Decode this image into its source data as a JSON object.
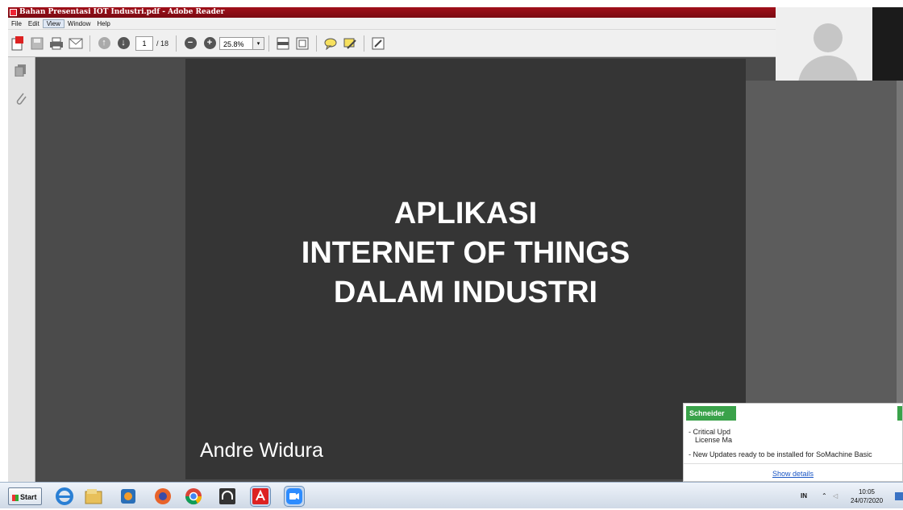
{
  "window": {
    "title": "Bahan Presentasi IOT Industri.pdf - Adobe Reader"
  },
  "menu": [
    "File",
    "Edit",
    "View",
    "Window",
    "Help"
  ],
  "toolbar": {
    "page_current": "1",
    "page_total": "/ 18",
    "zoom": "25.8%",
    "zoom_dropdown": "▾",
    "zoom_out_glyph": "−",
    "zoom_in_glyph": "+",
    "page_up_glyph": "↑",
    "page_down_glyph": "↓"
  },
  "slide": {
    "title_lines": [
      "APLIKASI",
      "INTERNET OF THINGS",
      "DALAM INDUSTRI"
    ],
    "author": "Andre Widura"
  },
  "notification": {
    "brand": "Schneider",
    "line1a": "- Critical Upd",
    "line1b": "License Ma",
    "line2": "- New Updates ready to be installed for SoMachine Basic",
    "details": "Show details"
  },
  "taskbar": {
    "start": "Start",
    "lang": "IN",
    "tray_up": "⌃",
    "tray_speaker": "◁",
    "time": "10:05",
    "date": "24/07/2020"
  },
  "colors": {
    "title_bar": "#a0101a",
    "slide_bg": "#353535",
    "viewport_bg": "#4b4b4b",
    "notification_brand": "#3aa24a",
    "link": "#1a56c5"
  }
}
